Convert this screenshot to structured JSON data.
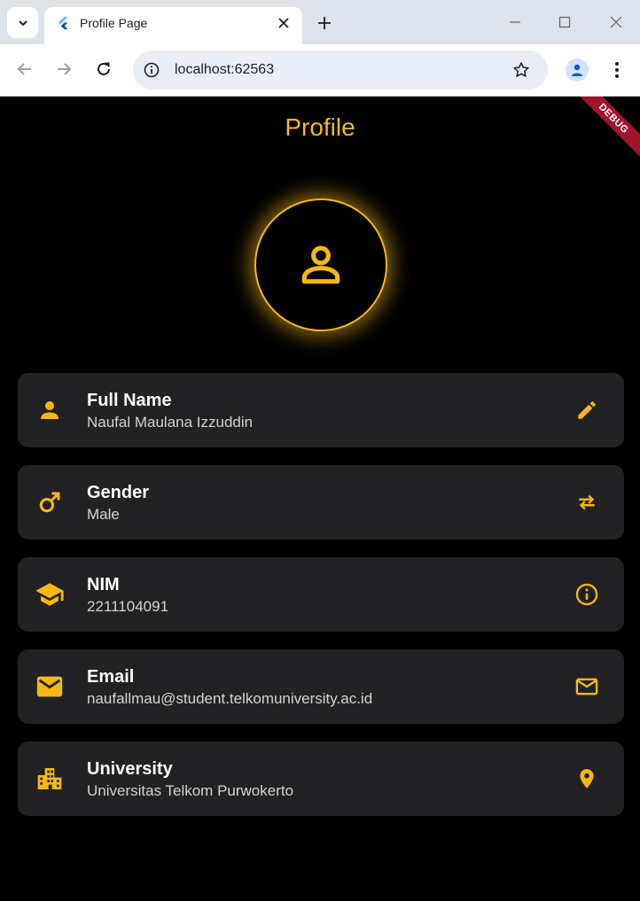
{
  "browser": {
    "tab_title": "Profile Page",
    "url": "localhost:62563"
  },
  "app": {
    "title": "Profile",
    "debug_label": "DEBUG",
    "accent_color": "#f5b814",
    "card_color": "#222224",
    "background_color": "#000000"
  },
  "avatar": {
    "icon": "person-outline-icon"
  },
  "cards": [
    {
      "title": "Full Name",
      "value": "Naufal Maulana Izzuddin",
      "lead_icon": "person-icon",
      "trail_icon": "edit-icon"
    },
    {
      "title": "Gender",
      "value": "Male",
      "lead_icon": "male-icon",
      "trail_icon": "swap-icon"
    },
    {
      "title": "NIM",
      "value": "2211104091",
      "lead_icon": "school-icon",
      "trail_icon": "info-icon"
    },
    {
      "title": "Email",
      "value": "naufallmau@student.telkomuniversity.ac.id",
      "lead_icon": "email-icon",
      "trail_icon": "mail-outline-icon"
    },
    {
      "title": "University",
      "value": "Universitas Telkom Purwokerto",
      "lead_icon": "business-icon",
      "trail_icon": "location-pin-icon"
    }
  ]
}
